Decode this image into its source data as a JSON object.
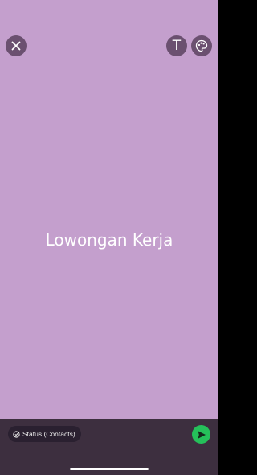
{
  "status": {
    "text": "Lowongan Kerja",
    "background_color": "#c49fcd"
  },
  "toolbar": {
    "close_icon": "close-icon",
    "text_tool_label": "T",
    "palette_icon": "palette-icon"
  },
  "footer": {
    "audience_label": "Status (Contacts)",
    "audience_icon": "status-icon",
    "send_icon": "send-icon",
    "send_color": "#25c05a"
  }
}
